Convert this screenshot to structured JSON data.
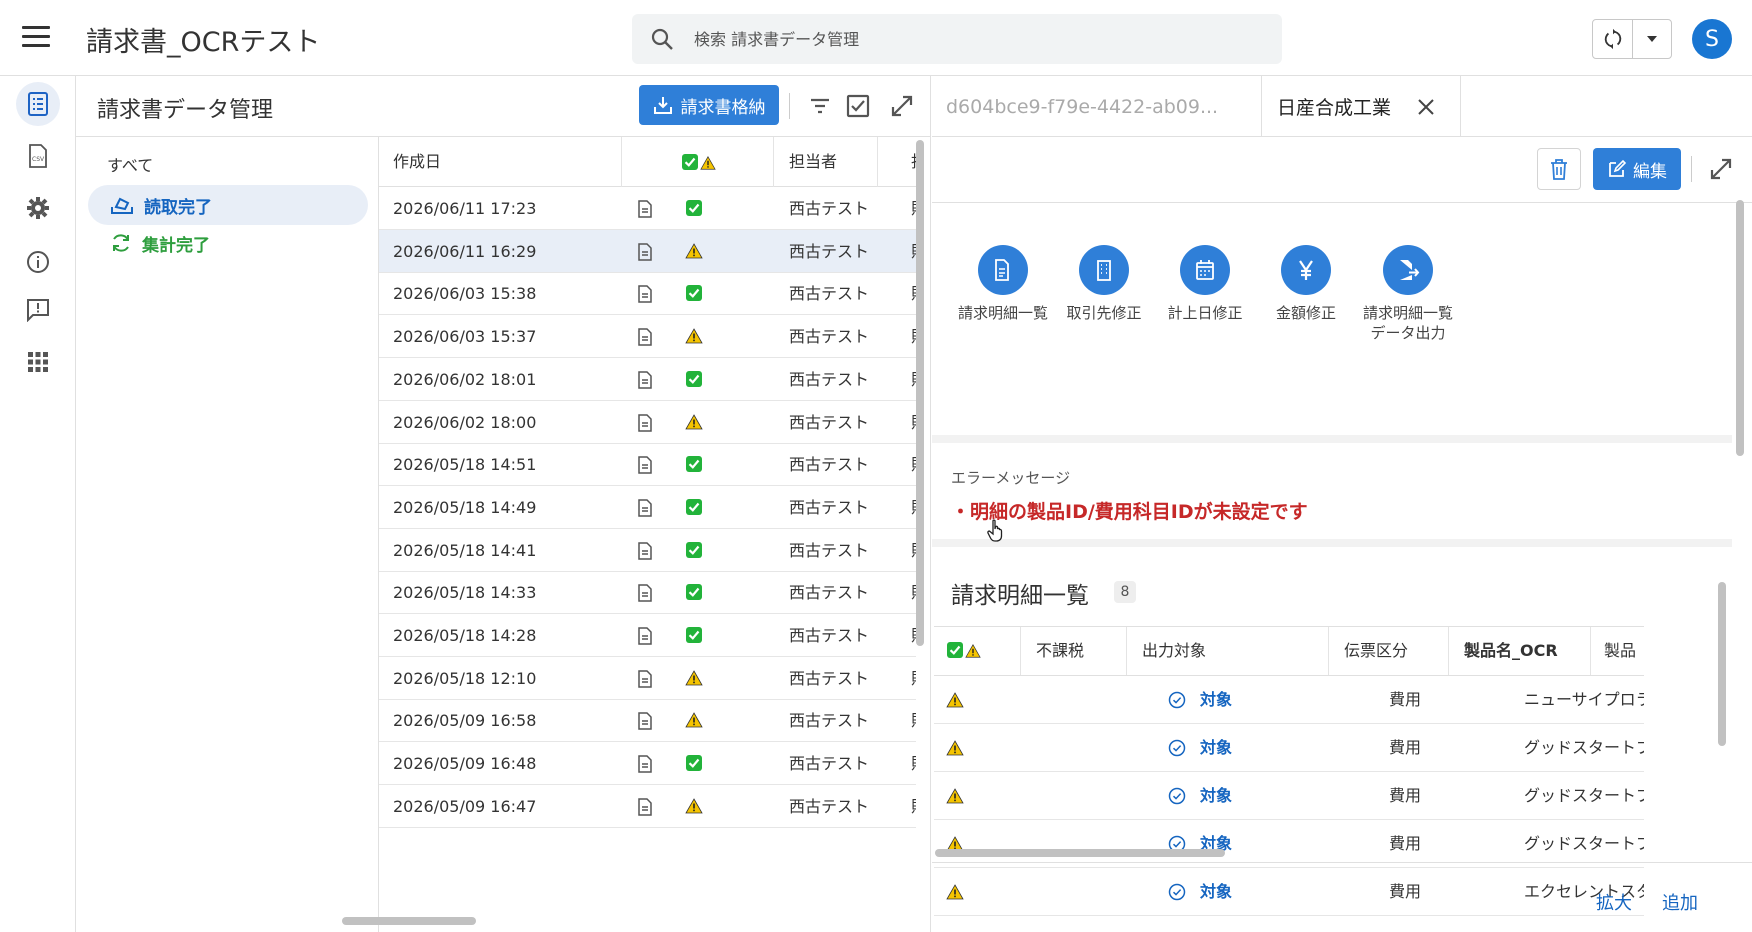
{
  "app": {
    "title": "請求書_OCRテスト"
  },
  "search": {
    "placeholder": "検索 請求書データ管理"
  },
  "user": {
    "avatar_letter": "S"
  },
  "colors": {
    "accent": "#2f7fd8",
    "success": "#2e9e3e",
    "error": "#c62828",
    "warning": "#f5c400"
  },
  "rail": {
    "items": [
      {
        "icon": "list-doc-icon",
        "active": true
      },
      {
        "icon": "csv-file-icon",
        "active": false
      },
      {
        "icon": "gear-icon",
        "active": false
      },
      {
        "icon": "info-icon",
        "active": false
      },
      {
        "icon": "feedback-icon",
        "active": false
      },
      {
        "icon": "apps-grid-icon",
        "active": false
      }
    ]
  },
  "list": {
    "title": "請求書データ管理",
    "store_button": "請求書格納",
    "filters": {
      "all": "すべて",
      "read_done": "読取完了",
      "agg_done": "集計完了"
    },
    "columns": {
      "created": "作成日",
      "owner": "担当者"
    },
    "rows": [
      {
        "date": "2026/06/11 17:23",
        "status": "ok",
        "owner": "西古テスト"
      },
      {
        "date": "2026/06/11 16:29",
        "status": "warn",
        "owner": "西古テスト",
        "selected": true
      },
      {
        "date": "2026/06/03 15:38",
        "status": "ok",
        "owner": "西古テスト"
      },
      {
        "date": "2026/06/03 15:37",
        "status": "warn",
        "owner": "西古テスト"
      },
      {
        "date": "2026/06/02 18:01",
        "status": "ok",
        "owner": "西古テスト"
      },
      {
        "date": "2026/06/02 18:00",
        "status": "warn",
        "owner": "西古テスト"
      },
      {
        "date": "2026/05/18 14:51",
        "status": "ok",
        "owner": "西古テスト"
      },
      {
        "date": "2026/05/18 14:49",
        "status": "ok",
        "owner": "西古テスト"
      },
      {
        "date": "2026/05/18 14:41",
        "status": "ok",
        "owner": "西古テスト"
      },
      {
        "date": "2026/05/18 14:33",
        "status": "ok",
        "owner": "西古テスト"
      },
      {
        "date": "2026/05/18 14:28",
        "status": "ok",
        "owner": "西古テスト"
      },
      {
        "date": "2026/05/18 12:10",
        "status": "warn",
        "owner": "西古テスト"
      },
      {
        "date": "2026/05/09 16:58",
        "status": "warn",
        "owner": "西古テスト"
      },
      {
        "date": "2026/05/09 16:48",
        "status": "ok",
        "owner": "西古テスト"
      },
      {
        "date": "2026/05/09 16:47",
        "status": "warn",
        "owner": "西古テスト"
      }
    ]
  },
  "detail": {
    "tab_id": "d604bce9-f79e-4422-ab09...",
    "tab_company": "日産合成工業",
    "edit_button": "編集",
    "actions": [
      {
        "label": "請求明細一覧",
        "icon": "document-icon"
      },
      {
        "label": "取引先修正",
        "icon": "building-icon"
      },
      {
        "label": "計上日修正",
        "icon": "calendar-icon"
      },
      {
        "label": "金額修正",
        "icon": "yen-icon"
      },
      {
        "label": "請求明細一覧\nデータ出力",
        "icon": "export-file-icon"
      }
    ],
    "error_label": "エラーメッセージ",
    "error_message": "・明細の製品ID/費用科目IDが未設定です",
    "items_title": "請求明細一覧",
    "items_count": "8",
    "item_columns": {
      "tax_free": "不課税",
      "output": "出力対象",
      "slip": "伝票区分",
      "product_ocr": "製品名_OCR",
      "product": "製品"
    },
    "items": [
      {
        "output": "対象",
        "slip": "費用",
        "product_ocr": "ニューサイプロラ..."
      },
      {
        "output": "対象",
        "slip": "費用",
        "product_ocr": "グッドスタートプ..."
      },
      {
        "output": "対象",
        "slip": "費用",
        "product_ocr": "グッドスタートプ..."
      },
      {
        "output": "対象",
        "slip": "費用",
        "product_ocr": "グッドスタートプ..."
      },
      {
        "output": "対象",
        "slip": "費用",
        "product_ocr": "エクセレントスタ..."
      }
    ],
    "bottom": {
      "expand": "拡大",
      "add": "追加"
    }
  }
}
